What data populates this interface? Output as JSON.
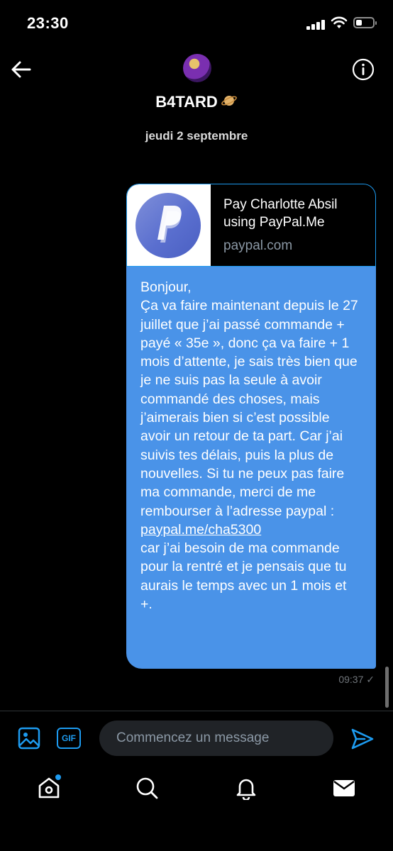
{
  "status_bar": {
    "time": "23:30"
  },
  "header": {
    "name": "B4TARD",
    "date_label": "jeudi 2 septembre"
  },
  "link_card": {
    "title": "Pay Charlotte Absil using PayPal.Me",
    "domain": "paypal.com"
  },
  "message": {
    "text_before_link": "Bonjour,\nÇa va faire maintenant depuis le 27 juillet que j’ai passé commande + payé « 35e », donc ça va faire + 1 mois d’attente, je sais très bien que je ne suis pas la seule à avoir commandé des choses, mais j’aimerais bien si c’est possible avoir un retour de ta part.  Car j’ai suivis tes délais, puis la plus de nouvelles. Si tu ne peux pas faire ma commande, merci de me rembourser à l’adresse paypal : ",
    "link_text": "paypal.me/cha5300",
    "text_after_link": "\ncar j’ai besoin de ma commande pour la rentré et je pensais que tu aurais le temps avec un 1 mois et +.",
    "time": "09:37",
    "status_icon": "sent-check-icon"
  },
  "composer": {
    "placeholder": "Commencez un message",
    "gif_label": "GIF"
  },
  "bottom_nav": {
    "items": [
      "home-icon",
      "search-icon",
      "notifications-icon",
      "messages-icon"
    ]
  },
  "colors": {
    "accent": "#1d9bf0",
    "bubble": "#4a93e8",
    "background": "#000000"
  }
}
